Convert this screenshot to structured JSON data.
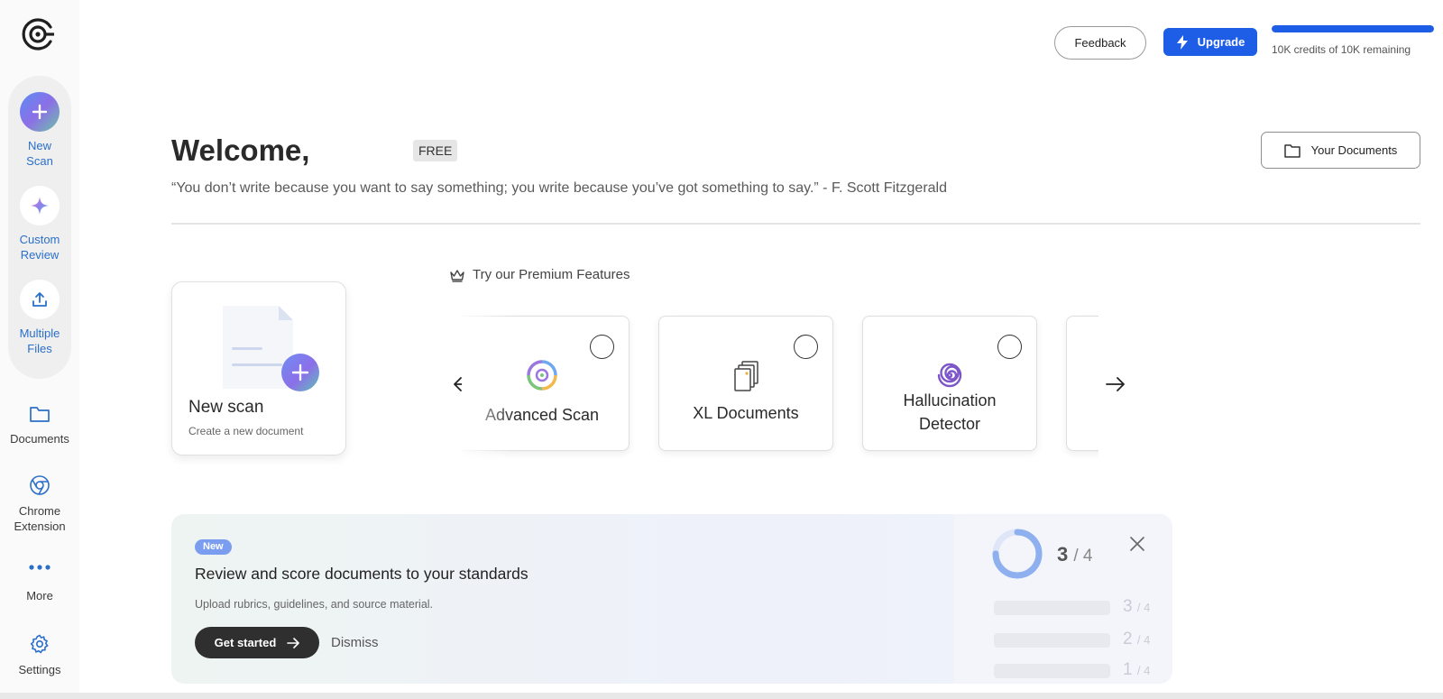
{
  "sidebar": {
    "quick_actions": [
      {
        "label": "New\nScan",
        "icon": "plus-icon"
      },
      {
        "label": "Custom\nReview",
        "icon": "sparkle-icon"
      },
      {
        "label": "Multiple\nFiles",
        "icon": "upload-icon"
      }
    ],
    "nav": [
      {
        "label": "Documents",
        "icon": "folder-icon"
      },
      {
        "label": "Chrome\nExtension",
        "icon": "chrome-icon"
      },
      {
        "label": "More",
        "icon": "more-dots-icon"
      },
      {
        "label": "Settings",
        "icon": "gear-icon"
      }
    ]
  },
  "topbar": {
    "feedback_label": "Feedback",
    "upgrade_label": "Upgrade",
    "credits_text": "10K credits of 10K remaining",
    "credits_fraction": 1.0
  },
  "header": {
    "welcome": "Welcome,",
    "plan_badge": "FREE",
    "quote": "“You don’t write because you want to say something; you write because you’ve got something to say.” - F. Scott Fitzgerald",
    "your_documents_label": "Your Documents"
  },
  "new_scan_card": {
    "title": "New scan",
    "subtitle": "Create a new document"
  },
  "premium": {
    "heading": "Try our Premium Features",
    "features": [
      {
        "title": "Advanced Scan",
        "icon": "advanced-scan-icon"
      },
      {
        "title": "XL Documents",
        "icon": "documents-stack-icon"
      },
      {
        "title": "Hallucination\nDetector",
        "icon": "spiral-icon"
      }
    ]
  },
  "banner": {
    "badge": "New",
    "title": "Review and score documents to your standards",
    "subtitle": "Upload rubrics, guidelines, and source material.",
    "get_started_label": "Get started",
    "dismiss_label": "Dismiss",
    "score": {
      "value": "3",
      "total": "/ 4",
      "fraction": 0.75
    },
    "rows": [
      {
        "value": "3",
        "total": "/ 4"
      },
      {
        "value": "2",
        "total": "/ 4"
      },
      {
        "value": "1",
        "total": "/ 4"
      }
    ]
  },
  "colors": {
    "accent": "#1e5de6",
    "sidebar_label": "#2a6fc9"
  }
}
